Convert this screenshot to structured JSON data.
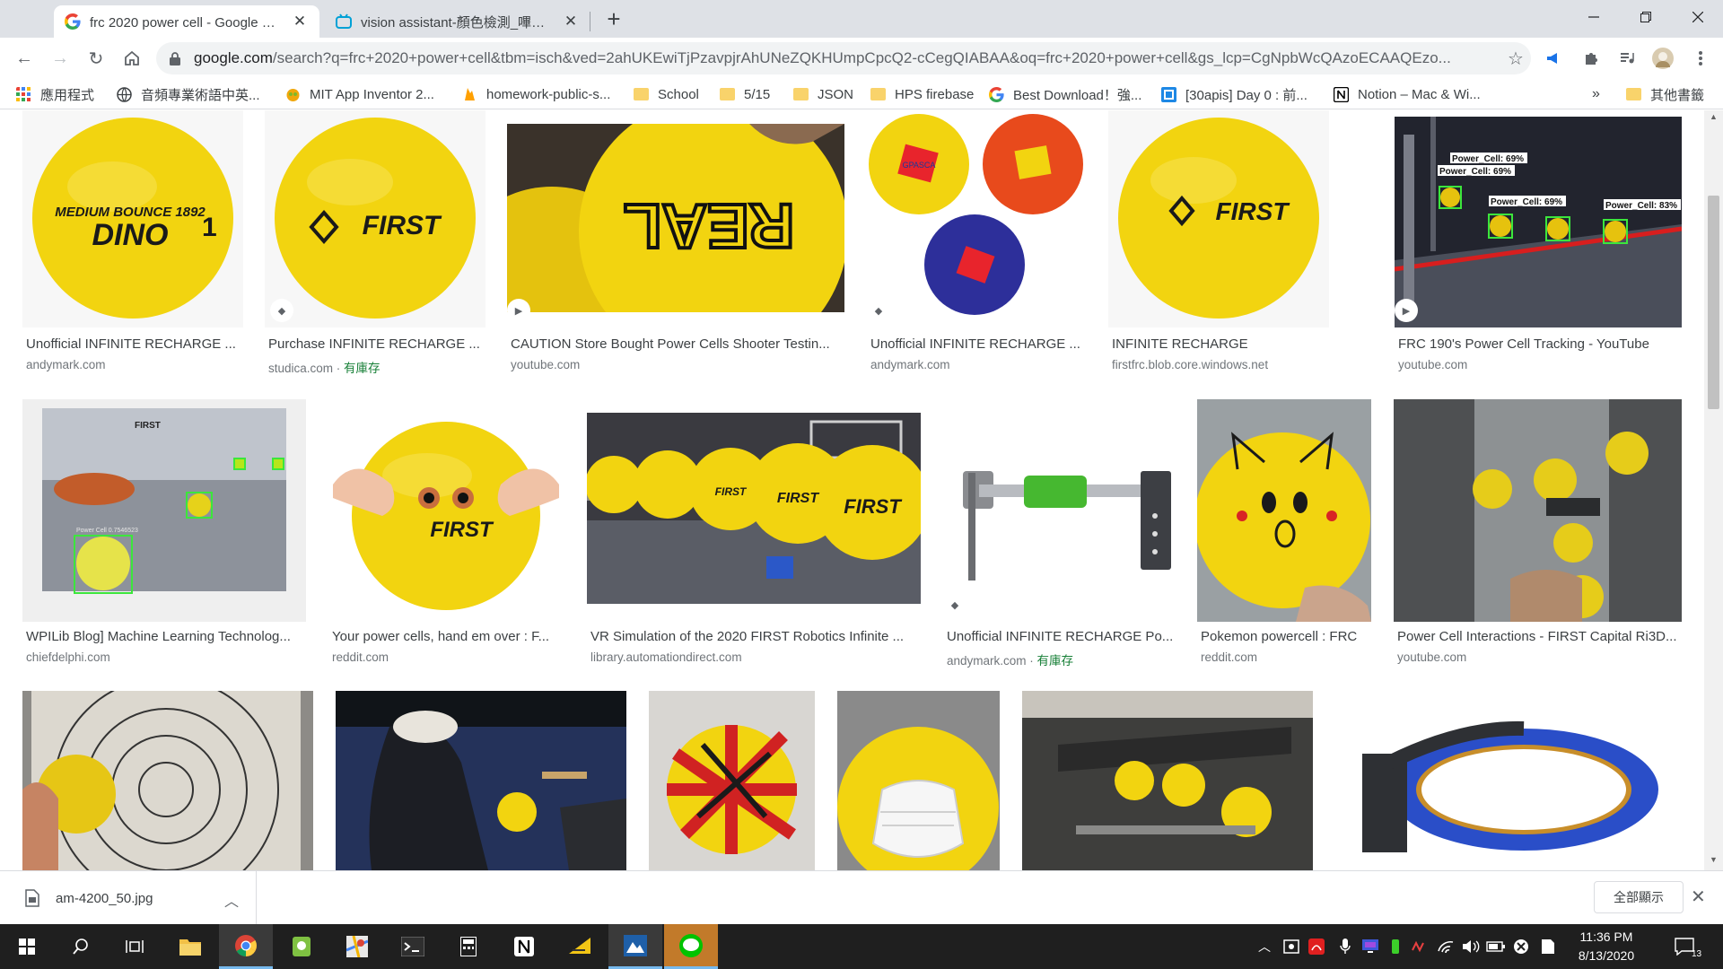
{
  "tabs": [
    {
      "title": "frc 2020 power cell - Google 搜尋",
      "favicon": "google-g-icon",
      "active": true
    },
    {
      "title": "vision assistant-顏色檢測_嗶哩嗶哩",
      "favicon": "bilibili-tv-icon",
      "active": false
    }
  ],
  "omnibox": {
    "domain": "google.com",
    "path": "/search?q=frc+2020+power+cell&tbm=isch&ved=2ahUKEwiTjPzavpjrAhUNeZQKHUmpCpcQ2-cCegQIABAA&oq=frc+2020+power+cell&gs_lcp=CgNpbWcQAzoECAAQEzo..."
  },
  "bookmarks": [
    {
      "label": "應用程式",
      "icon": "apps-grid-icon"
    },
    {
      "label": "音頻專業術語中英...",
      "icon": "globe-icon"
    },
    {
      "label": "MIT App Inventor 2...",
      "icon": "app-inventor-icon"
    },
    {
      "label": "homework-public-s...",
      "icon": "firebase-icon"
    },
    {
      "label": "School",
      "icon": "folder-icon"
    },
    {
      "label": "5/15",
      "icon": "folder-icon"
    },
    {
      "label": "JSON",
      "icon": "folder-icon"
    },
    {
      "label": "HPS firebase",
      "icon": "folder-icon"
    },
    {
      "label": "Best Download！強...",
      "icon": "google-g-icon"
    },
    {
      "label": "[30apis] Day 0 : 前...",
      "icon": "ithome-icon"
    },
    {
      "label": "Notion – Mac & Wi...",
      "icon": "notion-icon"
    }
  ],
  "bookmarks_overflow": "»",
  "other_bookmarks": "其他書籤",
  "results": [
    {
      "title": "Unofficial INFINITE RECHARGE ...",
      "source": "andymark.com",
      "badge": ""
    },
    {
      "title": "Purchase INFINITE RECHARGE ...",
      "source": "studica.com",
      "stock": "有庫存",
      "badge": "tag"
    },
    {
      "title": "CAUTION Store Bought Power Cells Shooter Testin...",
      "source": "youtube.com",
      "badge": "play"
    },
    {
      "title": "Unofficial INFINITE RECHARGE ...",
      "source": "andymark.com",
      "badge": "tag"
    },
    {
      "title": "INFINITE RECHARGE",
      "source": "firstfrc.blob.core.windows.net",
      "badge": ""
    },
    {
      "title": "FRC 190's Power Cell Tracking - YouTube",
      "source": "youtube.com",
      "badge": "play"
    },
    {
      "title": "WPILib Blog] Machine Learning Technolog...",
      "source": "chiefdelphi.com",
      "badge": ""
    },
    {
      "title": "Your power cells, hand em over : F...",
      "source": "reddit.com",
      "badge": ""
    },
    {
      "title": "VR Simulation of the 2020 FIRST Robotics Infinite ...",
      "source": "library.automationdirect.com",
      "badge": ""
    },
    {
      "title": "Unofficial INFINITE RECHARGE Po...",
      "source": "andymark.com",
      "stock": "有庫存",
      "badge": "tag"
    },
    {
      "title": "Pokemon powercell : FRC",
      "source": "reddit.com",
      "badge": ""
    },
    {
      "title": "Power Cell Interactions - FIRST Capital Ri3D...",
      "source": "youtube.com",
      "badge": ""
    }
  ],
  "thumb_text": {
    "dino_1": "MEDIUM BOUNCE 1892",
    "dino_2": "DINO",
    "dino_3": "1",
    "first": "FIRST",
    "real": "REAL",
    "gpasca": "GPASCA",
    "tracking_label": "Power_Cell: 69%",
    "tracking_label_2": "Power_Cell: 83%",
    "wpilib_title": "FIRST",
    "wpilib_label": "Power Cell 0.7546523"
  },
  "download": {
    "filename": "am-4200_50.jpg",
    "show_all": "全部顯示"
  },
  "taskbar": {
    "time": "11:36 PM",
    "date": "8/13/2020",
    "notifications": "13"
  },
  "colors": {
    "ball_yellow": "#f2d410",
    "accent_blue": "#1a73e8",
    "stock_green": "#188038"
  }
}
